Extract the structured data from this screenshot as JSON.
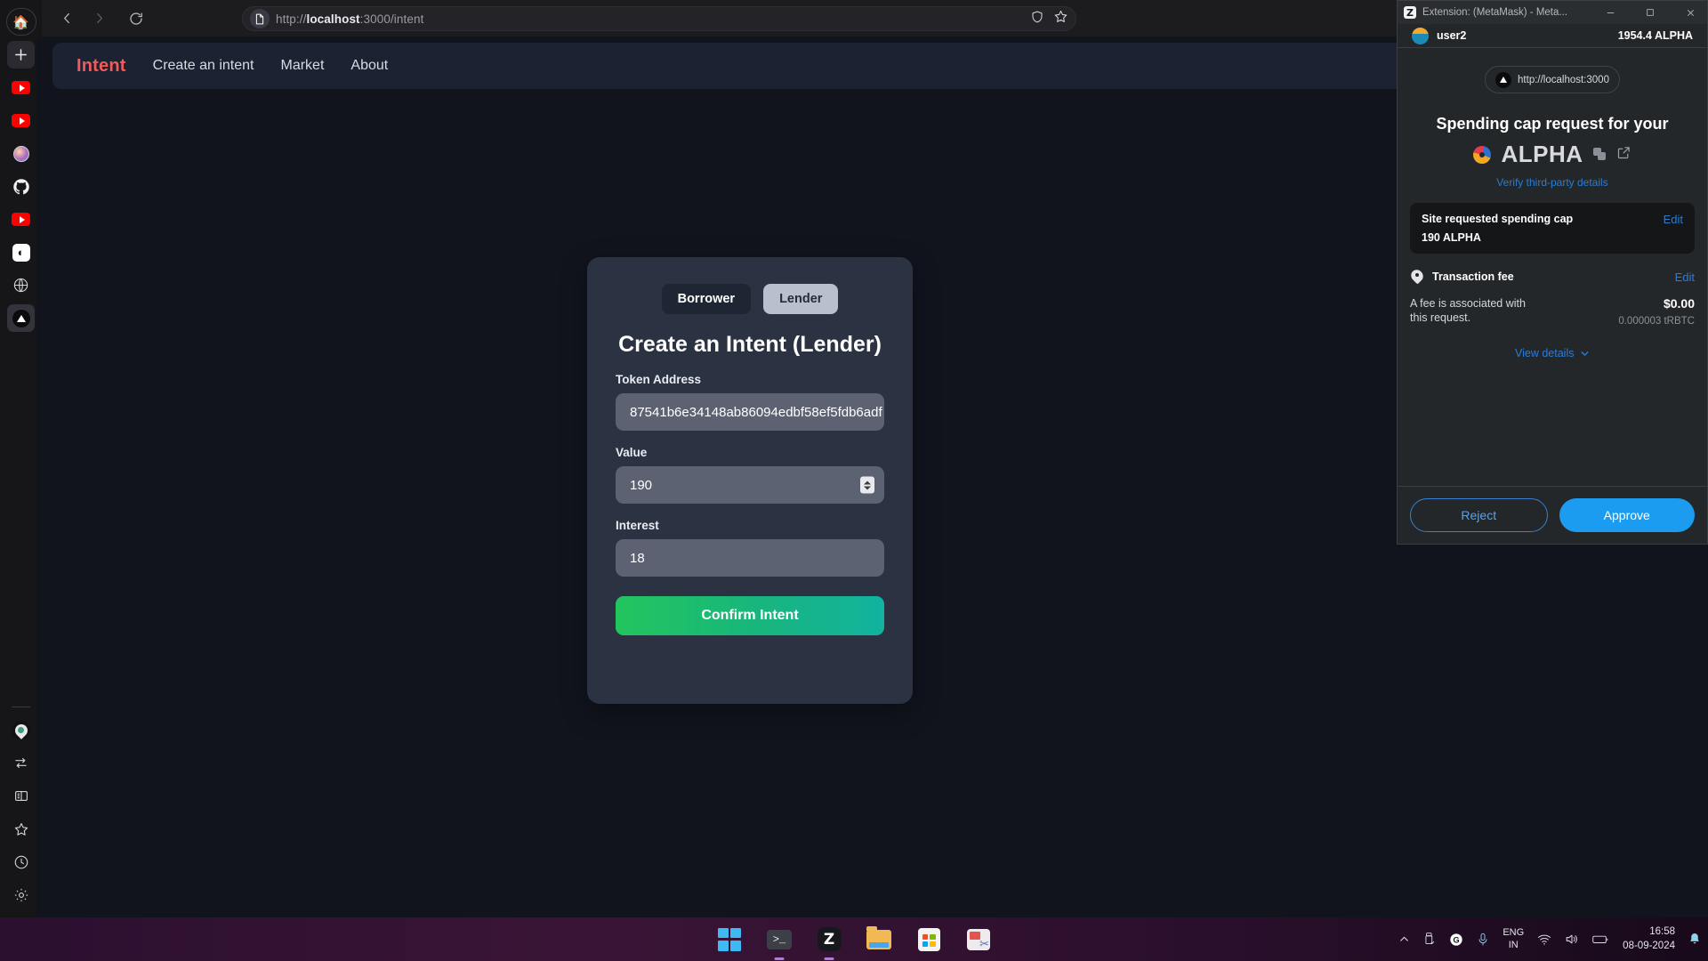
{
  "browser": {
    "back_icon": "chevron-left",
    "forward_icon": "chevron-right",
    "reload_icon": "reload",
    "url_display": "http://localhost:3000/intent",
    "url_host": "localhost",
    "url_scheme": "http://",
    "url_path": ":3000/intent",
    "page_icon": "document-icon",
    "shield_icon": "shield-icon",
    "bookmark_icon": "star-icon",
    "sidebar_items": [
      {
        "name": "home",
        "icon": "home-icon"
      },
      {
        "name": "new-tab",
        "icon": "plus-icon"
      },
      {
        "name": "youtube-1",
        "icon": "youtube-icon"
      },
      {
        "name": "youtube-2",
        "icon": "youtube-icon"
      },
      {
        "name": "profile",
        "icon": "avatar-icon"
      },
      {
        "name": "github",
        "icon": "github-icon"
      },
      {
        "name": "youtube-3",
        "icon": "youtube-icon"
      },
      {
        "name": "openai",
        "icon": "openai-icon"
      },
      {
        "name": "web",
        "icon": "globe-icon"
      },
      {
        "name": "localhost",
        "icon": "triangle-icon"
      }
    ],
    "sidebar_bottom": [
      {
        "name": "location-profile",
        "icon": "location-pin-icon"
      },
      {
        "name": "sync",
        "icon": "sync-arrows-icon"
      },
      {
        "name": "split-view",
        "icon": "split-view-icon"
      },
      {
        "name": "bookmarks",
        "icon": "star-icon"
      },
      {
        "name": "history",
        "icon": "clock-icon"
      },
      {
        "name": "settings",
        "icon": "gear-icon"
      }
    ]
  },
  "site": {
    "brand": "Intent",
    "nav": [
      {
        "label": "Create an intent"
      },
      {
        "label": "Market"
      },
      {
        "label": "About"
      }
    ],
    "card": {
      "role_tabs": [
        {
          "label": "Borrower",
          "active": false
        },
        {
          "label": "Lender",
          "active": true
        }
      ],
      "title": "Create an Intent (Lender)",
      "fields": [
        {
          "label": "Token Address",
          "value": "87541b6e34148ab86094edbf58ef5fdb6adf",
          "type": "text"
        },
        {
          "label": "Value",
          "value": "190",
          "type": "number"
        },
        {
          "label": "Interest",
          "value": "18",
          "type": "number"
        }
      ],
      "submit_label": "Confirm Intent"
    }
  },
  "metamask": {
    "window_title": "Extension: (MetaMask) - Meta...",
    "minimize_icon": "minimize-icon",
    "maximize_icon": "maximize-icon",
    "close_icon": "close-icon",
    "account_name": "user2",
    "account_balance": "1954.4 ALPHA",
    "origin": "http://localhost:3000",
    "heading": "Spending cap request for your",
    "token_symbol": "ALPHA",
    "copy_icon": "copy-icon",
    "external_link_icon": "external-link-icon",
    "verify_link": "Verify third-party details",
    "spending_cap": {
      "label": "Site requested spending cap",
      "edit_label": "Edit",
      "amount": "190 ALPHA"
    },
    "transaction_fee": {
      "icon": "tag-icon",
      "label": "Transaction fee",
      "edit_label": "Edit",
      "description": "A fee is associated with this request.",
      "fiat": "$0.00",
      "native": "0.000003 tRBTC"
    },
    "view_details_label": "View details",
    "view_details_icon": "chevron-down-icon",
    "reject_label": "Reject",
    "approve_label": "Approve"
  },
  "taskbar": {
    "apps": [
      {
        "name": "start",
        "icon": "windows-logo-icon"
      },
      {
        "name": "terminal",
        "icon": "terminal-icon"
      },
      {
        "name": "zen-browser",
        "icon": "zen-icon",
        "label": "Z"
      },
      {
        "name": "file-explorer",
        "icon": "folder-icon"
      },
      {
        "name": "microsoft-store",
        "icon": "store-icon"
      },
      {
        "name": "snipping-tool",
        "icon": "snip-icon"
      }
    ],
    "tray": {
      "overflow_icon": "chevron-up-icon",
      "usb_icon": "usb-icon",
      "grammarly_icon": "grammarly-icon",
      "grammarly_label": "G",
      "mic_icon": "microphone-icon",
      "lang_line1": "ENG",
      "lang_line2": "IN",
      "wifi_icon": "wifi-icon",
      "volume_icon": "speaker-icon",
      "battery_icon": "battery-icon",
      "time": "16:58",
      "date": "08-09-2024",
      "notification_icon": "bell-icon"
    }
  }
}
